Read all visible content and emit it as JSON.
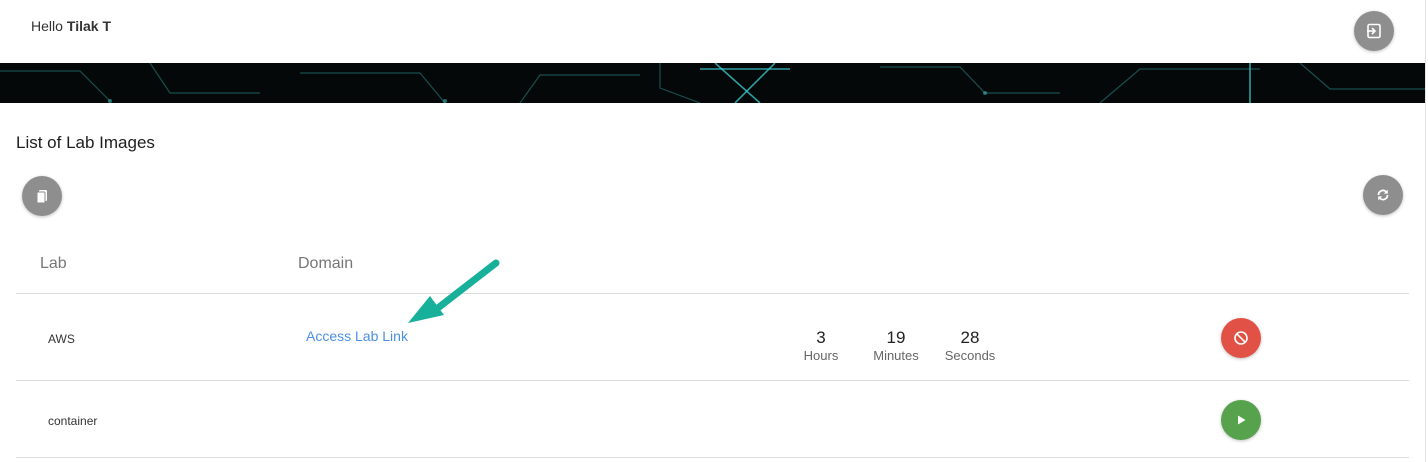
{
  "header": {
    "greeting": "Hello",
    "user_name": "Tilak T",
    "logout_icon": "logout-icon"
  },
  "page": {
    "title": "List of Lab Images",
    "copy_icon": "copy-icon",
    "refresh_icon": "refresh-icon"
  },
  "table": {
    "columns": [
      "Lab",
      "Domain"
    ],
    "rows": [
      {
        "lab": "AWS",
        "domain_link": "Access Lab Link",
        "timer": {
          "hours": "3",
          "hours_label": "Hours",
          "minutes": "19",
          "minutes_label": "Minutes",
          "seconds": "28",
          "seconds_label": "Seconds"
        },
        "action_icon": "stop-icon",
        "action_color": "#e25145"
      },
      {
        "lab": "container",
        "action_icon": "play-icon",
        "action_color": "#56a24d"
      }
    ]
  },
  "colors": {
    "link": "#4a90e2",
    "fab_gray": "#8e8e8e",
    "banner_bg": "#040808",
    "banner_circuit": "#3fd0d4",
    "annotation_arrow": "#17b09a"
  }
}
